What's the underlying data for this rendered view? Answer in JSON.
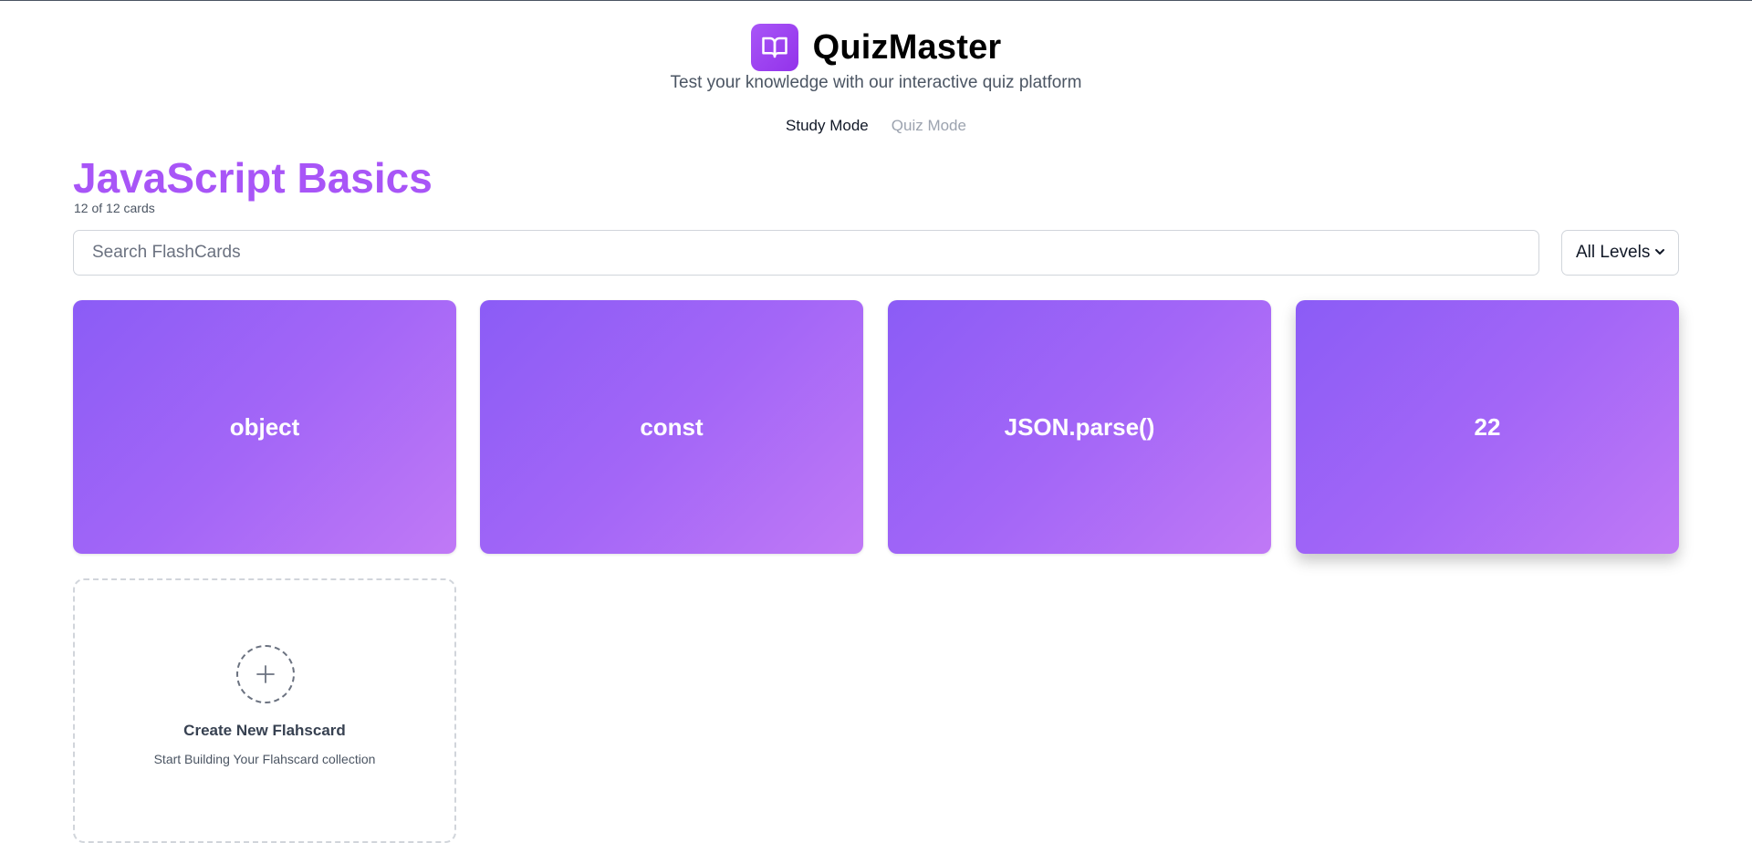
{
  "app": {
    "title": "QuizMaster",
    "tagline": "Test your knowledge with our interactive quiz platform",
    "logo_icon": "book-open-icon",
    "accent": "#a855f7"
  },
  "modes": [
    {
      "label": "Study Mode",
      "active": true
    },
    {
      "label": "Quiz Mode",
      "active": false
    }
  ],
  "deck": {
    "title": "JavaScript Basics",
    "count_text": "12 of 12 cards"
  },
  "search": {
    "placeholder": "Search FlashCards",
    "value": ""
  },
  "level_filter": {
    "selected": "All Levels",
    "icon": "chevron-down-icon"
  },
  "cards": [
    {
      "front": "object"
    },
    {
      "front": "const"
    },
    {
      "front": "JSON.parse()"
    },
    {
      "front": "22"
    }
  ],
  "create_card": {
    "icon": "plus-icon",
    "title": "Create New Flahscard",
    "subtitle": "Start Building Your Flahscard collection"
  }
}
